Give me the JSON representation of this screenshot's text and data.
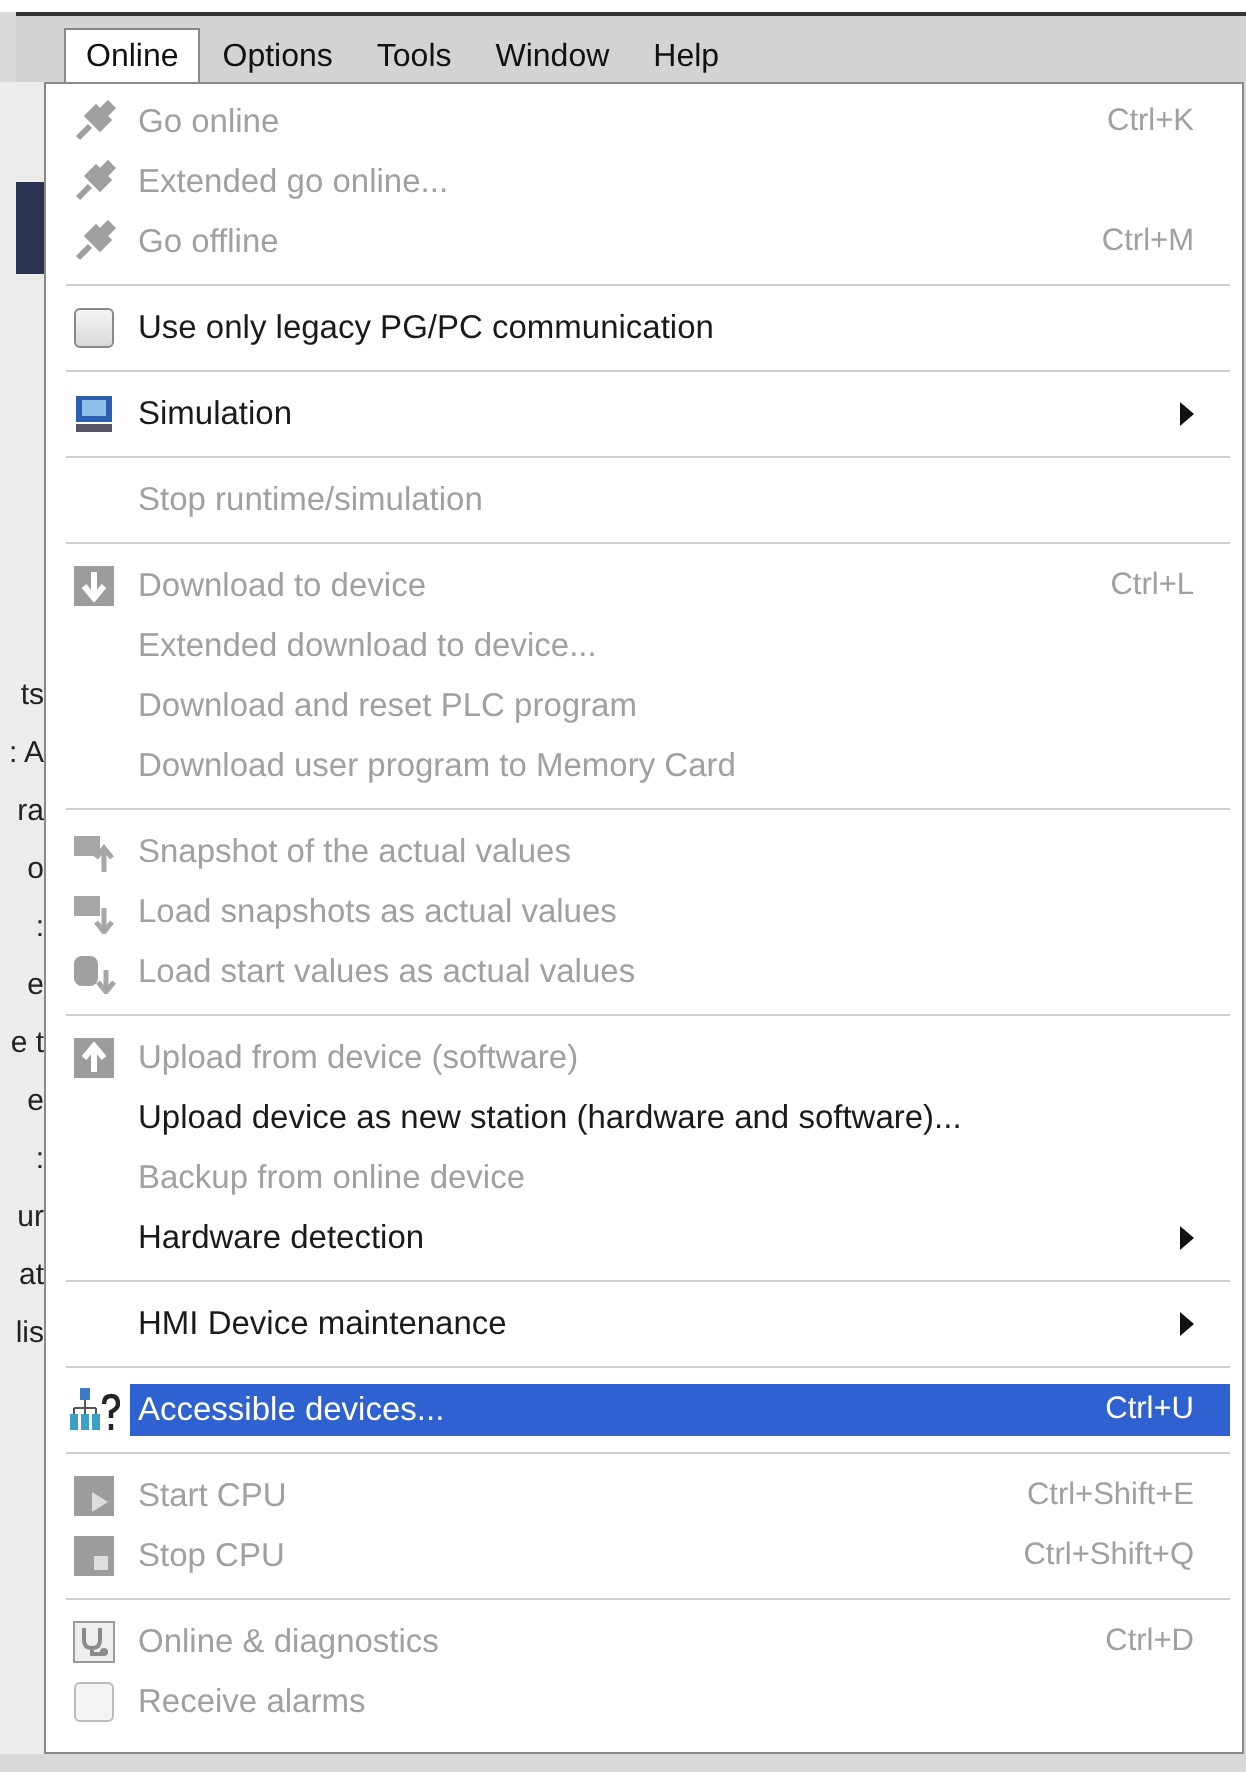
{
  "menubar": [
    {
      "label": "Online",
      "selected": true
    },
    {
      "label": "Options",
      "selected": false
    },
    {
      "label": "Tools",
      "selected": false
    },
    {
      "label": "Window",
      "selected": false
    },
    {
      "label": "Help",
      "selected": false
    }
  ],
  "background_fragments": [
    "ts",
    ": A",
    "ra",
    "o",
    ":",
    "e",
    "e t",
    "e",
    ":",
    "ur",
    "at",
    "lis"
  ],
  "menu": {
    "groups": [
      [
        {
          "kind": "command",
          "label": "Go online",
          "shortcut": "Ctrl+K",
          "disabled": true,
          "selected": false
        },
        {
          "kind": "command",
          "label": "Extended go online...",
          "disabled": true,
          "selected": false
        },
        {
          "kind": "command",
          "label": "Go offline",
          "shortcut": "Ctrl+M",
          "disabled": true,
          "selected": false
        }
      ],
      [
        {
          "kind": "checkbox",
          "label": "Use only legacy PG/PC communication",
          "checked": false,
          "disabled": false,
          "selected": false
        }
      ],
      [
        {
          "kind": "submenu",
          "label": "Simulation",
          "disabled": false,
          "selected": false
        }
      ],
      [
        {
          "kind": "command",
          "label": "Stop runtime/simulation",
          "disabled": true,
          "selected": false
        }
      ],
      [
        {
          "kind": "command",
          "label": "Download to device",
          "shortcut": "Ctrl+L",
          "disabled": true,
          "selected": false
        },
        {
          "kind": "command",
          "label": "Extended download to device...",
          "disabled": true,
          "selected": false
        },
        {
          "kind": "command",
          "label": "Download and reset PLC program",
          "disabled": true,
          "selected": false
        },
        {
          "kind": "command",
          "label": "Download user program to Memory Card",
          "disabled": true,
          "selected": false
        }
      ],
      [
        {
          "kind": "command",
          "label": "Snapshot of the actual values",
          "disabled": true,
          "selected": false
        },
        {
          "kind": "command",
          "label": "Load snapshots as actual values",
          "disabled": true,
          "selected": false
        },
        {
          "kind": "command",
          "label": "Load start values as actual values",
          "disabled": true,
          "selected": false
        }
      ],
      [
        {
          "kind": "command",
          "label": "Upload from device (software)",
          "disabled": true,
          "selected": false
        },
        {
          "kind": "command",
          "label": "Upload device as new station (hardware and software)...",
          "disabled": false,
          "selected": false
        },
        {
          "kind": "command",
          "label": "Backup from online device",
          "disabled": true,
          "selected": false
        },
        {
          "kind": "submenu",
          "label": "Hardware detection",
          "disabled": false,
          "selected": false
        }
      ],
      [
        {
          "kind": "submenu",
          "label": "HMI Device maintenance",
          "disabled": false,
          "selected": false
        }
      ],
      [
        {
          "kind": "command",
          "label": "Accessible devices...",
          "shortcut": "Ctrl+U",
          "disabled": false,
          "selected": true
        }
      ],
      [
        {
          "kind": "command",
          "label": "Start CPU",
          "shortcut": "Ctrl+Shift+E",
          "disabled": true,
          "selected": false
        },
        {
          "kind": "command",
          "label": "Stop CPU",
          "shortcut": "Ctrl+Shift+Q",
          "disabled": true,
          "selected": false
        }
      ],
      [
        {
          "kind": "command",
          "label": "Online & diagnostics",
          "shortcut": "Ctrl+D",
          "disabled": true,
          "selected": false
        },
        {
          "kind": "checkbox",
          "label": "Receive alarms",
          "checked": false,
          "disabled": true,
          "selected": false
        }
      ]
    ]
  }
}
